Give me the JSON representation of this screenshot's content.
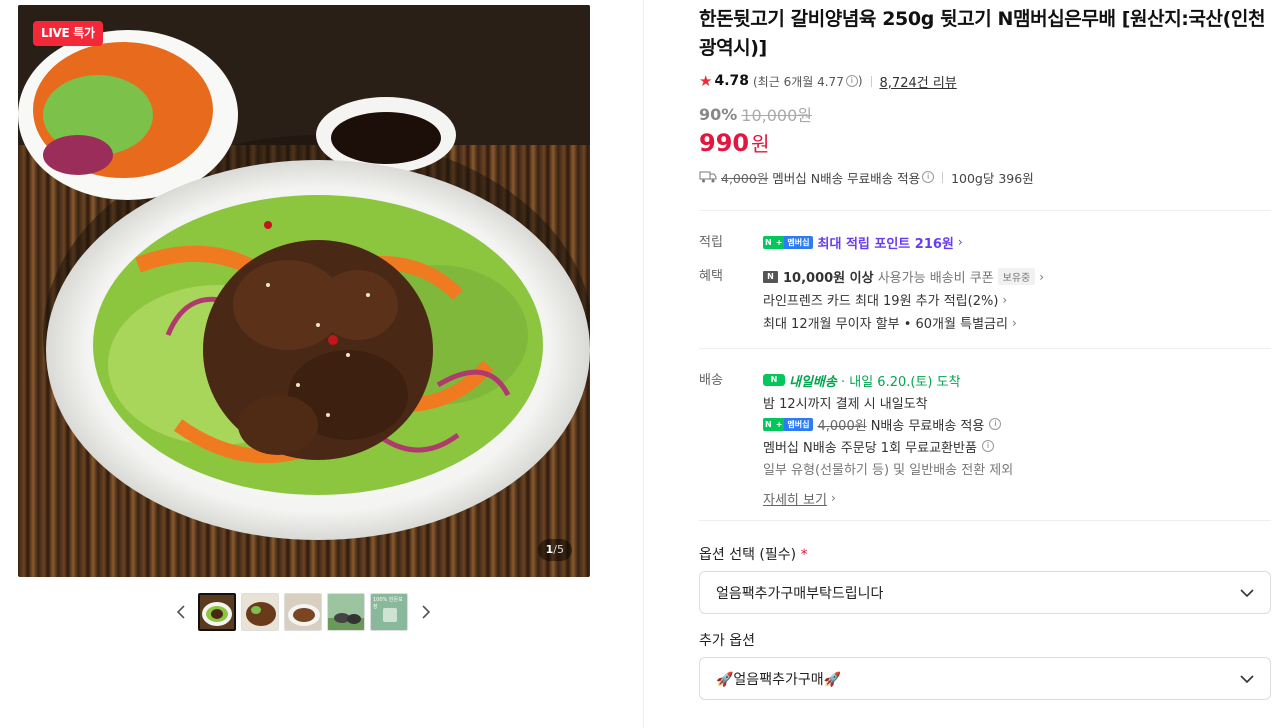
{
  "gallery": {
    "live_badge": "LIVE 특가",
    "counter_current": "1",
    "counter_total": "/5",
    "prev_icon": "chevron-left-icon",
    "next_icon": "chevron-right-icon",
    "thumbnail_5_text": "100% 한돈보장"
  },
  "product": {
    "title": "한돈뒷고기 갈비양념육 250g 뒷고기 N맴버십은무배 [원산지:국산(인천광역시)]",
    "rating": "4.78",
    "rating_recent": "(최근 6개월 4.77",
    "rating_recent_close": ")",
    "review_count": "8,724건 리뷰",
    "discount_rate": "90%",
    "original_price": "10,000원",
    "final_price": "990",
    "currency": "원",
    "shipping_original": "4,000원",
    "shipping_text": "멤버십 N배송 무료배송 적용",
    "unit_price": "100g당 396원"
  },
  "benefits": {
    "points_label": "적립",
    "points_text": "최대 적립 포인트 216원",
    "benefit_label": "혜택",
    "coupon_bold": "10,000원 이상",
    "coupon_text": "사용가능 배송비 쿠폰",
    "coupon_tag": "보유중",
    "card_text": "라인프렌즈 카드 최대 19원 추가 적립(2%)",
    "installment_text": "최대 12개월 무이자 할부 • 60개월 특별금리"
  },
  "delivery": {
    "label": "배송",
    "tomorrow_badge": "N",
    "tomorrow_title": "내일배송",
    "tomorrow_date": "· 내일 6.20.(토) 도착",
    "cutoff_text": "밤 12시까지 결제 시 내일도착",
    "fee_original": "4,000원",
    "fee_text": "N배송 무료배송 적용",
    "exchange_text": "멤버십 N배송 주문당 1회 무료교환반품",
    "exclusion_text": "일부 유형(선물하기 등) 및 일반배송 전환 제외",
    "detail_link": "자세히 보기"
  },
  "membership_badge": {
    "n": "N",
    "plus": "+",
    "m": "멤버십"
  },
  "options": {
    "required_label": "옵션 선택 (필수)",
    "required_mark": "*",
    "required_value": "얼음팩추가구매부탁드립니다",
    "extra_label": "추가 옵션",
    "extra_value": "🚀얼음팩추가구매🚀"
  },
  "colors": {
    "accent_red": "#e3163f",
    "live_red": "#f5283a",
    "naver_green": "#03c75a",
    "points_purple": "#6a3cf0"
  }
}
